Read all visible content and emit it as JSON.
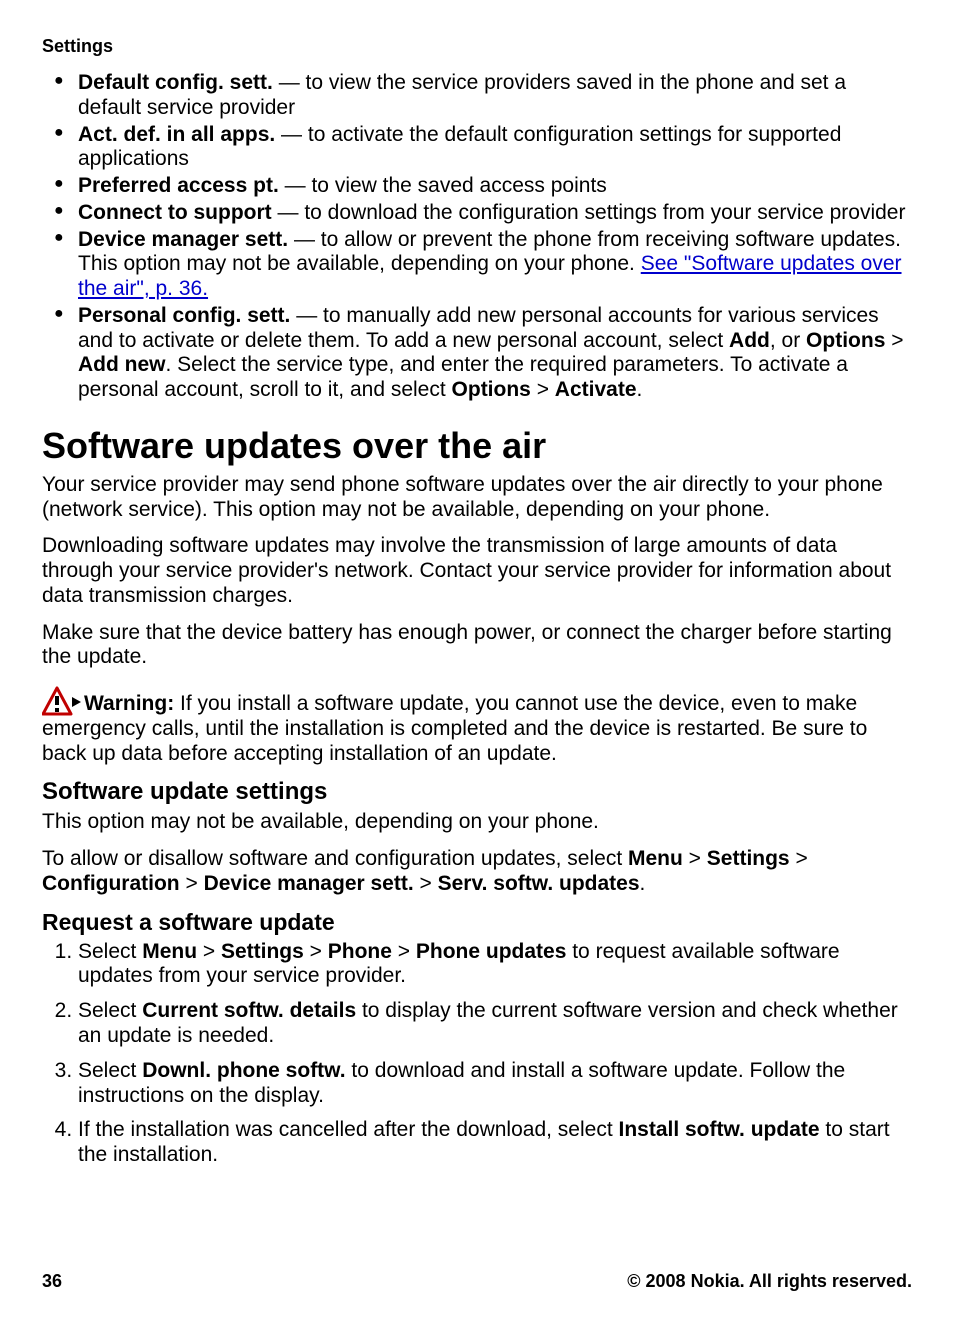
{
  "header": "Settings",
  "bullets": {
    "b1_label": "Default config. sett.",
    "b1_text": "  —  to view the service providers saved in the phone and set a default service provider",
    "b2_label": "Act. def. in all apps.",
    "b2_text": "  —  to activate the default configuration settings for supported applications",
    "b3_label": "Preferred access pt.",
    "b3_text": "  —  to view the saved access points",
    "b4_label": "Connect to support",
    "b4_text": "  —  to download the configuration settings from your service provider",
    "b5_label": "Device manager sett.",
    "b5_text1": "  —  to allow or prevent the phone from receiving software updates. This option may not be available, depending on your phone. ",
    "b5_link": "See \"Software updates over the air\", p. 36.",
    "b6_label": "Personal config. sett.",
    "b6_text1": "  —  to manually add new personal accounts for various services and to activate or delete them. To add a new personal account, select ",
    "b6_add": "Add",
    "b6_text2": ", or ",
    "b6_options1": "Options",
    "b6_gt1": " > ",
    "b6_addnew": "Add new",
    "b6_text3": ". Select the service type, and enter the required parameters. To activate a personal account, scroll to it, and select ",
    "b6_options2": "Options",
    "b6_gt2": " > ",
    "b6_activate": "Activate",
    "b6_period": "."
  },
  "h1": "Software updates over the air",
  "p1": "Your service provider may send phone software updates over the air directly to your phone (network service). This option may not be available, depending on your phone.",
  "p2": "Downloading software updates may involve the transmission of large amounts of data through your service provider's network. Contact your service provider for information about data transmission charges.",
  "p3": "Make sure that the device battery has enough power, or connect the charger before starting the update.",
  "warn_label": "Warning:",
  "warn_text": "  If you install a software update, you cannot use the device, even to make emergency calls, until the installation is completed and the device is restarted. Be sure to back up data before accepting installation of an update.",
  "h2": "Software update settings",
  "sus_p1": "This option may not be available, depending on your phone.",
  "sus_p2_t1": "To allow or disallow software and configuration updates, select ",
  "sus_p2_menu": "Menu",
  "sus_p2_gt1": " > ",
  "sus_p2_settings": "Settings",
  "sus_p2_gt2": " > ",
  "sus_p2_config": "Configuration",
  "sus_p2_gt3": " > ",
  "sus_p2_dms": "Device manager sett.",
  "sus_p2_gt4": " > ",
  "sus_p2_ssu": "Serv. softw. updates",
  "sus_p2_period": ".",
  "h3": "Request a software update",
  "step1_t1": "Select ",
  "step1_menu": "Menu",
  "step1_gt1": " > ",
  "step1_settings": "Settings",
  "step1_gt2": " > ",
  "step1_phone": "Phone",
  "step1_gt3": " > ",
  "step1_pu": "Phone updates",
  "step1_t2": " to request available software updates from your service provider.",
  "step2_t1": "Select ",
  "step2_csd": "Current softw. details",
  "step2_t2": " to display the current software version and check whether an update is needed.",
  "step3_t1": "Select ",
  "step3_dps": "Downl. phone softw.",
  "step3_t2": " to download and install a software update. Follow the instructions on the display.",
  "step4_t1": "If the installation was cancelled after the download, select ",
  "step4_isu": "Install softw. update",
  "step4_t2": " to start the installation.",
  "footer_left": "36",
  "footer_right": "© 2008 Nokia. All rights reserved."
}
